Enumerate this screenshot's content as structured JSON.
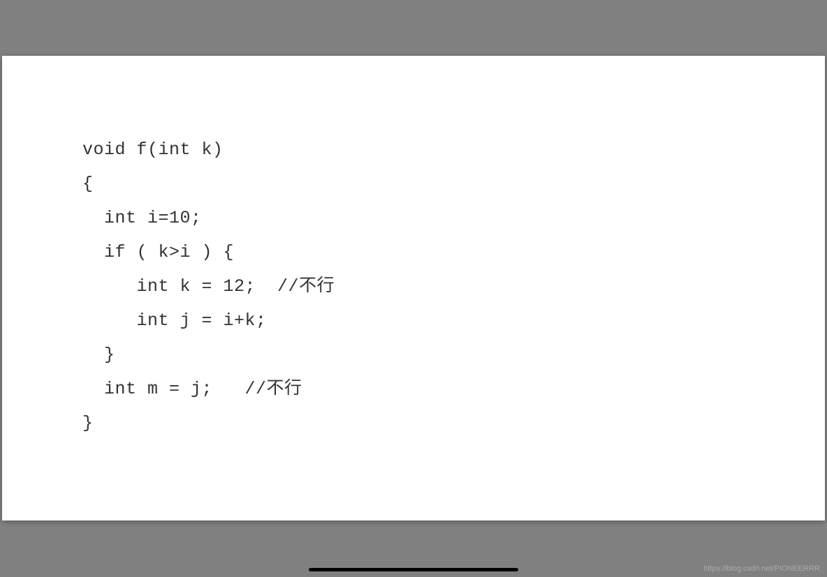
{
  "code": {
    "line1": "void f(int k)",
    "line2": "{",
    "line3": "  int i=10;",
    "line4": "  if ( k>i ) {",
    "line5": "     int k = 12;  //不行",
    "line6": "     int j = i+k;",
    "line7": "  }",
    "line8": "  int m = j;   //不行",
    "line9": "}"
  },
  "watermark": "https://blog.csdn.net/PIONEERRR"
}
